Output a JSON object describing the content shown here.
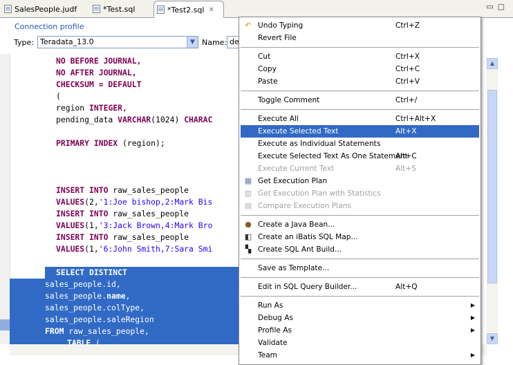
{
  "tabs": [
    {
      "label": "SalesPeople.judf"
    },
    {
      "label": "*Test.sql"
    },
    {
      "label": "*Test2.sql",
      "active": true
    }
  ],
  "window_controls": "▭ ▢",
  "connection": {
    "legend": "Connection profile",
    "type_label": "Type:",
    "type_value": "Teradata_13.0",
    "name_label": "Name:",
    "name_value": "de"
  },
  "code": [
    [
      [
        "kw",
        "NO BEFORE JOURNAL,"
      ]
    ],
    [
      [
        "kw",
        "NO AFTER JOURNAL,"
      ]
    ],
    [
      [
        "kw",
        "CHECKSUM = DEFAULT"
      ]
    ],
    [
      [
        "t",
        "("
      ]
    ],
    [
      [
        "t",
        "region "
      ],
      [
        "kw",
        "INTEGER"
      ],
      [
        "t",
        ","
      ]
    ],
    [
      [
        "t",
        "pending_data "
      ],
      [
        "kw",
        "VARCHAR"
      ],
      [
        "t",
        "(1024) "
      ],
      [
        "kw",
        "CHARAC"
      ]
    ],
    [
      [
        "t",
        ""
      ]
    ],
    [
      [
        "kw",
        "PRIMARY INDEX"
      ],
      [
        "t",
        " (region);"
      ]
    ],
    [
      [
        "t",
        ""
      ]
    ],
    [
      [
        "t",
        ""
      ]
    ],
    [
      [
        "t",
        ""
      ]
    ],
    [
      [
        "kw",
        "INSERT INTO"
      ],
      [
        "t",
        " raw_sales_people"
      ]
    ],
    [
      [
        "kw",
        "VALUES"
      ],
      [
        "t",
        "(2,"
      ],
      [
        "str",
        "'1:Joe bishop,2:Mark Bis"
      ]
    ],
    [
      [
        "kw",
        "INSERT INTO"
      ],
      [
        "t",
        " raw_sales_people"
      ]
    ],
    [
      [
        "kw",
        "VALUES"
      ],
      [
        "t",
        "(1,"
      ],
      [
        "str",
        "'3:Jack Brown,4:Mark Bro"
      ]
    ],
    [
      [
        "kw",
        "INSERT INTO"
      ],
      [
        "t",
        " raw_sales_people"
      ]
    ],
    [
      [
        "kw",
        "VALUES"
      ],
      [
        "t",
        "(1,"
      ],
      [
        "str",
        "'6:John Smith,7:Sara Smi"
      ]
    ],
    [
      [
        "t",
        ""
      ]
    ],
    [
      [
        "kw",
        "SELECT DISTINCT"
      ]
    ],
    [
      [
        "t",
        "sales_people.id,"
      ]
    ],
    [
      [
        "t",
        "sales_people."
      ],
      [
        "kw",
        "name"
      ],
      [
        "t",
        ","
      ]
    ],
    [
      [
        "t",
        "sales_people.colType,"
      ]
    ],
    [
      [
        "t",
        "sales_people.saleRegion"
      ]
    ],
    [
      [
        "kw",
        "FROM"
      ],
      [
        "t",
        " raw_sales_people,"
      ]
    ],
    [
      [
        "kw",
        "TABLE"
      ],
      [
        "t",
        " ("
      ]
    ]
  ],
  "menu": {
    "items": [
      {
        "label": "Undo Typing",
        "accel": "Ctrl+Z",
        "icon": "undo-icon"
      },
      {
        "label": "Revert File",
        "accel": ""
      },
      {
        "sep": true
      },
      {
        "label": "Cut",
        "accel": "Ctrl+X"
      },
      {
        "label": "Copy",
        "accel": "Ctrl+C"
      },
      {
        "label": "Paste",
        "accel": "Ctrl+V"
      },
      {
        "sep": true
      },
      {
        "label": "Toggle Comment",
        "accel": "Ctrl+/"
      },
      {
        "sep": true
      },
      {
        "label": "Execute All",
        "accel": "Ctrl+Alt+X"
      },
      {
        "label": "Execute Selected Text",
        "accel": "Alt+X",
        "highlighted": true
      },
      {
        "label": "Execute as Individual Statements",
        "accel": ""
      },
      {
        "label": "Execute Selected Text As One Statement",
        "accel": "Alt+C"
      },
      {
        "label": "Execute Current Text",
        "accel": "Alt+S",
        "disabled": true
      },
      {
        "label": "Get Execution Plan",
        "accel": "",
        "icon": "execution-plan-icon"
      },
      {
        "label": "Get Execution Plan with Statistics",
        "accel": "",
        "disabled": true,
        "icon": "execution-plan-stats-icon"
      },
      {
        "label": "Compare Execution Plans",
        "accel": "",
        "disabled": true,
        "icon": "compare-plans-icon"
      },
      {
        "sep": true
      },
      {
        "label": "Create a Java Bean...",
        "accel": "",
        "icon": "java-bean-icon"
      },
      {
        "label": "Create an iBatis SQL Map...",
        "accel": "",
        "icon": "ibatis-icon"
      },
      {
        "label": "Create SQL Ant Build...",
        "accel": "",
        "icon": "ant-build-icon"
      },
      {
        "sep": true
      },
      {
        "label": "Save as Template...",
        "accel": ""
      },
      {
        "sep": true
      },
      {
        "label": "Edit in SQL Query Builder...",
        "accel": "Alt+Q"
      },
      {
        "sep": true
      },
      {
        "label": "Run As",
        "accel": "",
        "submenu": true
      },
      {
        "label": "Debug As",
        "accel": "",
        "submenu": true
      },
      {
        "label": "Profile As",
        "accel": "",
        "submenu": true
      },
      {
        "label": "Validate",
        "accel": ""
      },
      {
        "label": "Team",
        "accel": "",
        "submenu": true
      }
    ]
  },
  "colors": {
    "selection": "#316ac5",
    "keyword": "#7f0055",
    "string": "#2a00ff",
    "legend": "#2255bb"
  }
}
